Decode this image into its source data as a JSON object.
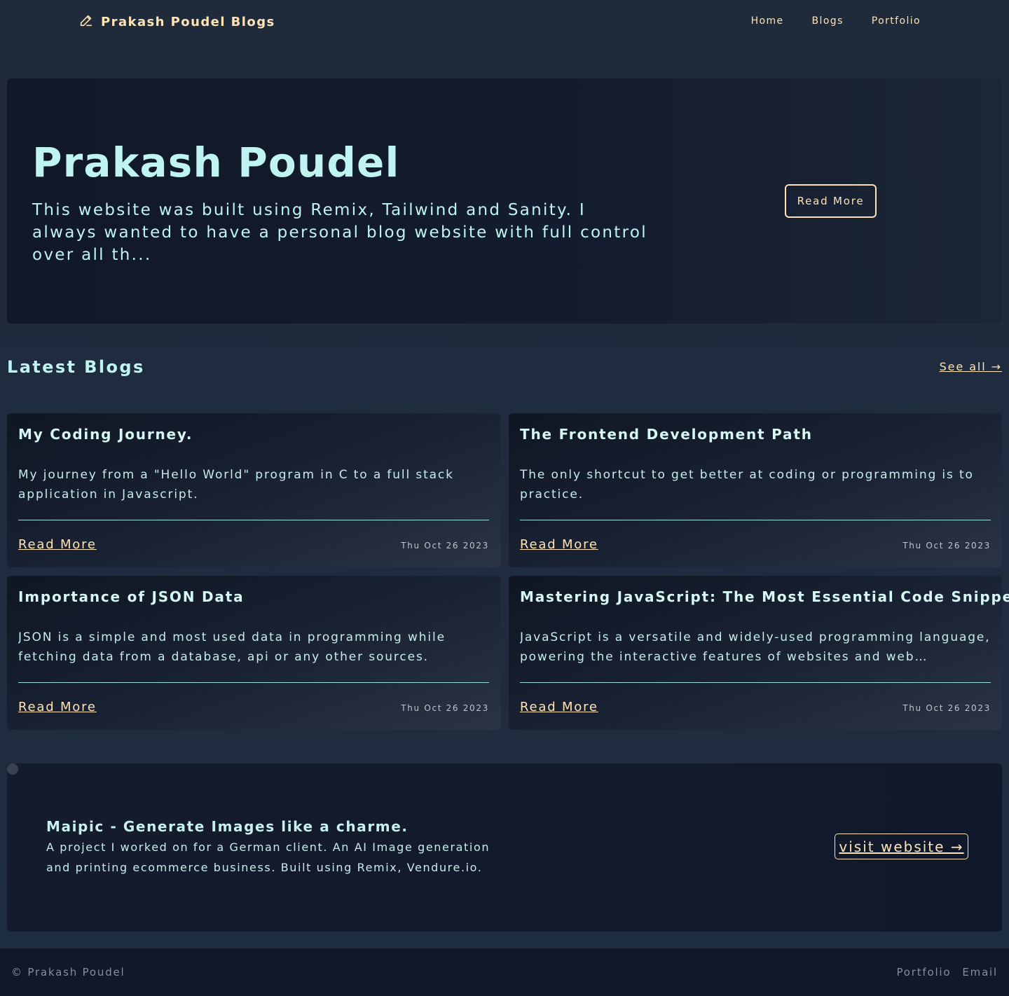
{
  "nav": {
    "brand": "Prakash Poudel Blogs",
    "brand_icon": "pencil-icon",
    "links": [
      "Home",
      "Blogs",
      "Portfolio"
    ]
  },
  "hero": {
    "title": "Prakash Poudel",
    "description": "This website was built using Remix, Tailwind and Sanity. I always wanted to have a personal blog website with full control over all th...",
    "button": "Read More"
  },
  "latest": {
    "title": "Latest Blogs",
    "see_all": "See all →"
  },
  "blogs": [
    {
      "title": "My Coding Journey.",
      "excerpt": "My journey from a \"Hello World\" program in C to a full stack application in Javascript.",
      "read_more": "Read More",
      "date": "Thu Oct 26 2023"
    },
    {
      "title": "The Frontend Development Path",
      "excerpt": "The only shortcut to get better at coding or programming is to practice.",
      "read_more": "Read More",
      "date": "Thu Oct 26 2023"
    },
    {
      "title": "Importance of JSON Data",
      "excerpt": "JSON is a simple and most used data in programming while fetching data from a database, api or any other sources.",
      "read_more": "Read More",
      "date": "Thu Oct 26 2023"
    },
    {
      "title": "Mastering JavaScript: The Most Essential Code Snippets",
      "excerpt": "JavaScript is a versatile and widely-used programming language, powering the interactive features of websites and web application...",
      "read_more": "Read More",
      "date": "Thu Oct 26 2023"
    }
  ],
  "project": {
    "title": "Maipic - Generate Images like a charme.",
    "description": "A project I worked on for a German client. An AI Image generation and printing ecommerce business. Built using Remix, Vendure.io.",
    "button": "visit website →"
  },
  "footer": {
    "copyright": "© Prakash Poudel",
    "links": [
      "Portfolio",
      "Email"
    ]
  },
  "colors": {
    "accent": "#fde3b5",
    "text": "#bff4f0",
    "background": "#1e293b"
  }
}
